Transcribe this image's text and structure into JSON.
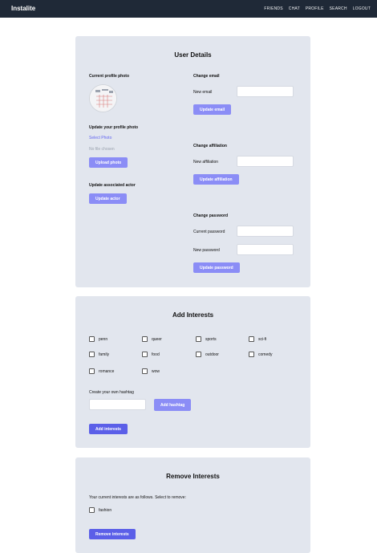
{
  "header": {
    "brand": "Instalite",
    "nav": [
      "FRIENDS",
      "CHAT",
      "PROFILE",
      "SEARCH",
      "LOGOUT"
    ]
  },
  "user_details": {
    "title": "User Details",
    "current_photo_label": "Current profile photo",
    "update_photo_label": "Update your profile photo",
    "select_photo": "Select Photo",
    "no_file": "No file chosen",
    "upload_button": "Upload photo",
    "associated_actor_label": "Update associated actor",
    "update_actor_button": "Update actor",
    "change_email_label": "Change email",
    "new_email_label": "New email",
    "new_email_value": "",
    "update_email_button": "Update email",
    "change_affiliation_label": "Change affiliation",
    "new_affiliation_label": "New affiliation",
    "new_affiliation_value": "",
    "update_affiliation_button": "Update affiliation",
    "change_password_label": "Change password",
    "current_password_label": "Current password",
    "current_password_value": "",
    "new_password_label": "New password",
    "new_password_value": "",
    "update_password_button": "Update password"
  },
  "add_interests": {
    "title": "Add Interests",
    "options": [
      "penn",
      "queer",
      "sports",
      "sci-fi",
      "family",
      "food",
      "outdoor",
      "comedy",
      "romance",
      "wow"
    ],
    "hashtag_label": "Create your own hashtag",
    "hashtag_value": "",
    "add_hashtag_button": "Add hashtag",
    "add_interests_button": "Add interests"
  },
  "remove_interests": {
    "title": "Remove Interests",
    "description": "Your current interests are as follows. Select to remove:",
    "options": [
      "fashion"
    ],
    "remove_button": "Remove interests"
  }
}
